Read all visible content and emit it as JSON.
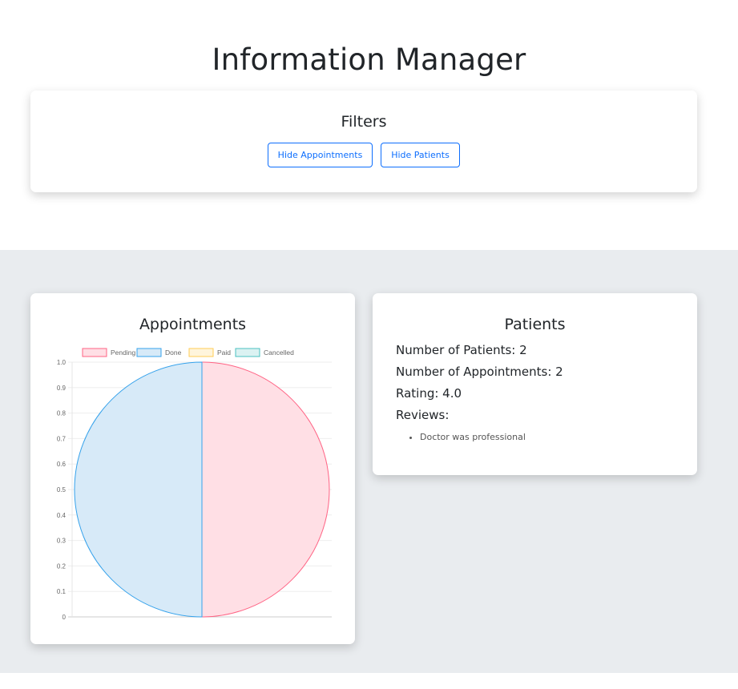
{
  "header": {
    "title": "Information Manager"
  },
  "filters": {
    "title": "Filters",
    "hide_appointments_label": "Hide Appointments",
    "hide_patients_label": "Hide Patients",
    "accent_color": "#0d6efd"
  },
  "appointments": {
    "title": "Appointments",
    "chart_data": {
      "type": "pie",
      "categories": [
        "Pending",
        "Done",
        "Paid",
        "Cancelled"
      ],
      "values": [
        1,
        1,
        0,
        0
      ],
      "colors": {
        "fill": [
          "#ffdfe5",
          "#d7eaf8",
          "#fff5dc",
          "#dbf2f2"
        ],
        "border": [
          "#ff6384",
          "#36a2eb",
          "#ffcd56",
          "#4bc0c0"
        ]
      },
      "legend_position": "top",
      "yaxis_ticks": [
        "0",
        "0.1",
        "0.2",
        "0.3",
        "0.4",
        "0.5",
        "0.6",
        "0.7",
        "0.8",
        "0.9",
        "1.0"
      ],
      "ylim": [
        0,
        1
      ],
      "grid": true
    }
  },
  "patients": {
    "title": "Patients",
    "num_patients_label": "Number of Patients: 2",
    "num_appointments_label": "Number of Appointments: 2",
    "rating_label": "Rating: 4.0",
    "reviews_label": "Reviews:",
    "reviews": [
      "Doctor was professional"
    ]
  }
}
